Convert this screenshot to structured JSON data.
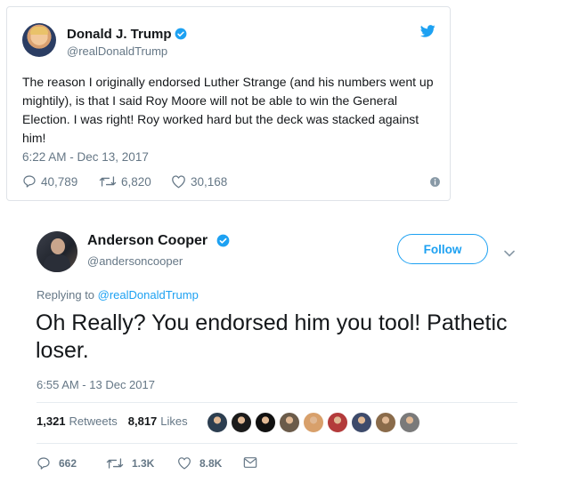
{
  "tweet1": {
    "author_name": "Donald J. Trump",
    "handle": "@realDonaldTrump",
    "text": "The reason I originally endorsed Luther Strange (and his numbers went up mightily), is that I said Roy Moore will not be able to win the General Election. I was right! Roy worked hard but the deck was stacked against him!",
    "timestamp": "6:22 AM - Dec 13, 2017",
    "replies": "40,789",
    "retweets": "6,820",
    "likes": "30,168",
    "icons": {
      "verified": "verified-badge-icon",
      "brand": "twitter-bird-icon",
      "info": "info-icon"
    }
  },
  "tweet2": {
    "author_name": "Anderson Cooper",
    "handle": "@andersoncooper",
    "follow_label": "Follow",
    "replying_prefix": "Replying to ",
    "replying_to": "@realDonaldTrump",
    "text": "Oh Really? You endorsed him you tool! Pathetic loser.",
    "timestamp": "6:55 AM - 13 Dec 2017",
    "retweets_count": "1,321",
    "retweets_label": "Retweets",
    "likes_count": "8,817",
    "likes_label": "Likes",
    "liker_avatar_colors": [
      "#2c3e50",
      "#1b1b1b",
      "#111111",
      "#6b5b4a",
      "#d8a06b",
      "#b33b3b",
      "#3d4a6b",
      "#8a6b4a",
      "#7a7a7a"
    ],
    "reply_count": "662",
    "retweet_count_short": "1.3K",
    "like_count_short": "8.8K"
  },
  "colors": {
    "accent": "#1da1f2",
    "muted": "#657786",
    "text": "#14171a"
  }
}
